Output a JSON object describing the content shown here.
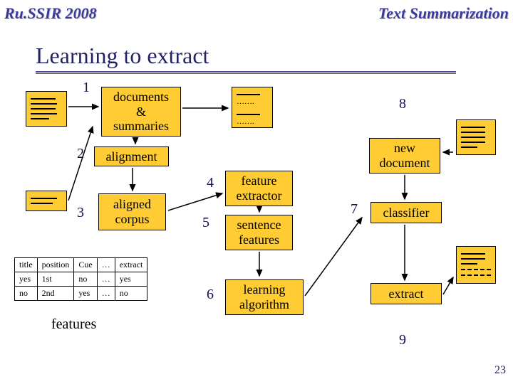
{
  "header": {
    "left": "Ru.SSIR 2008",
    "right": "Text Summarization"
  },
  "title": "Learning to extract",
  "steps": {
    "n1": "1",
    "n2": "2",
    "n3": "3",
    "n4": "4",
    "n5": "5",
    "n6": "6",
    "n7": "7",
    "n8": "8",
    "n9": "9"
  },
  "boxes": {
    "docs_summaries_l1": "documents",
    "docs_summaries_l2": "&",
    "docs_summaries_l3": "summaries",
    "alignment": "alignment",
    "aligned_corpus_l1": "aligned",
    "aligned_corpus_l2": "corpus",
    "feature_extractor_l1": "feature",
    "feature_extractor_l2": "extractor",
    "sentence_features_l1": "sentence",
    "sentence_features_l2": "features",
    "learning_algo_l1": "learning",
    "learning_algo_l2": "algorithm",
    "new_document_l1": "new",
    "new_document_l2": "document",
    "classifier": "classifier",
    "extract": "extract"
  },
  "table": {
    "headers": [
      "title",
      "position",
      "Cue",
      "…",
      "extract"
    ],
    "rows": [
      [
        "yes",
        "1st",
        "no",
        "…",
        "yes"
      ],
      [
        "no",
        "2nd",
        "yes",
        "…",
        "no"
      ]
    ]
  },
  "features_label": "features",
  "slide_number": "23"
}
